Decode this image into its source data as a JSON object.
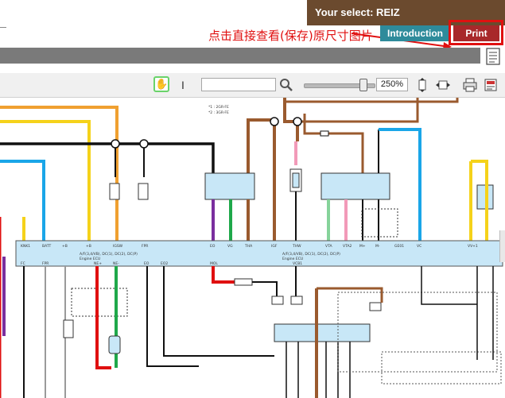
{
  "header": {
    "select_text": "Your select: REIZ",
    "note_cn": "点击直接查看(保存)原尺寸图片",
    "intro_label": "Introduction",
    "print_label": "Print"
  },
  "toolbar": {
    "search_value": "",
    "zoom_value": "250%",
    "zoom_level": 0.85
  },
  "diagram": {
    "ecu_pins_top": [
      "KNK1",
      "BATT",
      "+B",
      "+B",
      "IGSW",
      "FPR",
      "EO",
      "VG",
      "THA",
      "IGF",
      "THW",
      "VTA",
      "VTA2",
      "M+",
      "M-",
      "GE01",
      "VC",
      "VV+1"
    ],
    "ecu_pins_bottom": [
      "FC",
      "FPR",
      "NE+",
      "NE-",
      "EO",
      "EO2",
      "MOL",
      "VCB1"
    ],
    "ecu_title_left": "A/F(3,4/VB), DC(1), DC(2), DC(P)",
    "ecu_sub_left": "Engine ECU",
    "ecu_title_right": "A/F(3,4/VB), DC(1), DC(2), DC(P)",
    "ecu_sub_right": "Engine ECU",
    "notes": [
      "*1 : 2GR-FE",
      "*2 : 3GR-FE"
    ],
    "wire_colors": {
      "brown": "#9a5a2e",
      "orange": "#f0a030",
      "yellow": "#f5d21a",
      "blue": "#1aa6e8",
      "black": "#111111",
      "red": "#e01010",
      "green": "#1fa84a",
      "purple": "#7a2e9e",
      "pink": "#f29ab8",
      "light-green": "#86d39a",
      "gray": "#9a9a9a"
    }
  }
}
